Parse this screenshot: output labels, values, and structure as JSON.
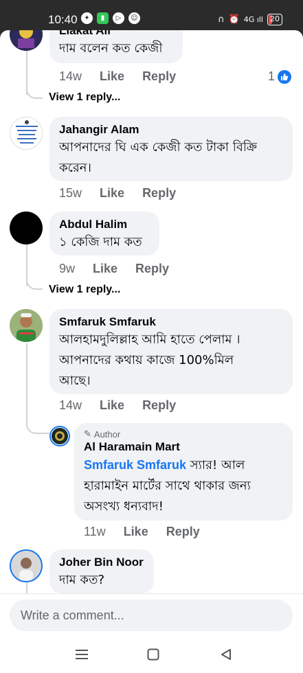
{
  "status": {
    "time": "10:40",
    "battery": "20",
    "signal_label": "4G"
  },
  "comments": [
    {
      "name": "Liakat Ali",
      "text": "দাম বলেন কত কেজী",
      "time": "14w",
      "like": "Like",
      "reply": "Reply",
      "reactions": "1",
      "view_replies": "View 1 reply..."
    },
    {
      "name": "Jahangir Alam",
      "text_line1": "আপনাদের  ঘি এক কেজী কত টাকা বিক্রি",
      "text_line2": "করেন।",
      "time": "15w",
      "like": "Like",
      "reply": "Reply"
    },
    {
      "name": "Abdul Halim",
      "text": "১ কেজি দাম কত",
      "time": "9w",
      "like": "Like",
      "reply": "Reply",
      "view_replies": "View 1 reply..."
    },
    {
      "name": "Smfaruk Smfaruk",
      "text_line1": "আলহামদুলিল্লাহ আমি হাতে পেলাম ।",
      "text_line2": "আপনাদের কথায় কাজে 100%মিল",
      "text_line3": "আছে।",
      "time": "14w",
      "like": "Like",
      "reply": "Reply",
      "reply_item": {
        "author_tag": "Author",
        "name": "Al Haramain Mart",
        "mention": "Smfaruk Smfaruk",
        "text_after_mention": " স্যার! আল",
        "text_line2": "হারামাইন মার্টের সাথে থাকার জন্য",
        "text_line3": "অসংখ্য ধন্যবাদ!",
        "time": "11w",
        "like": "Like",
        "reply": "Reply"
      }
    },
    {
      "name": "Joher Bin Noor",
      "text": "দাম কত?"
    }
  ],
  "composer": {
    "placeholder": "Write a comment..."
  },
  "colors": {
    "accent": "#1877f2",
    "bubble": "#f0f2f5",
    "muted": "#65676b"
  }
}
